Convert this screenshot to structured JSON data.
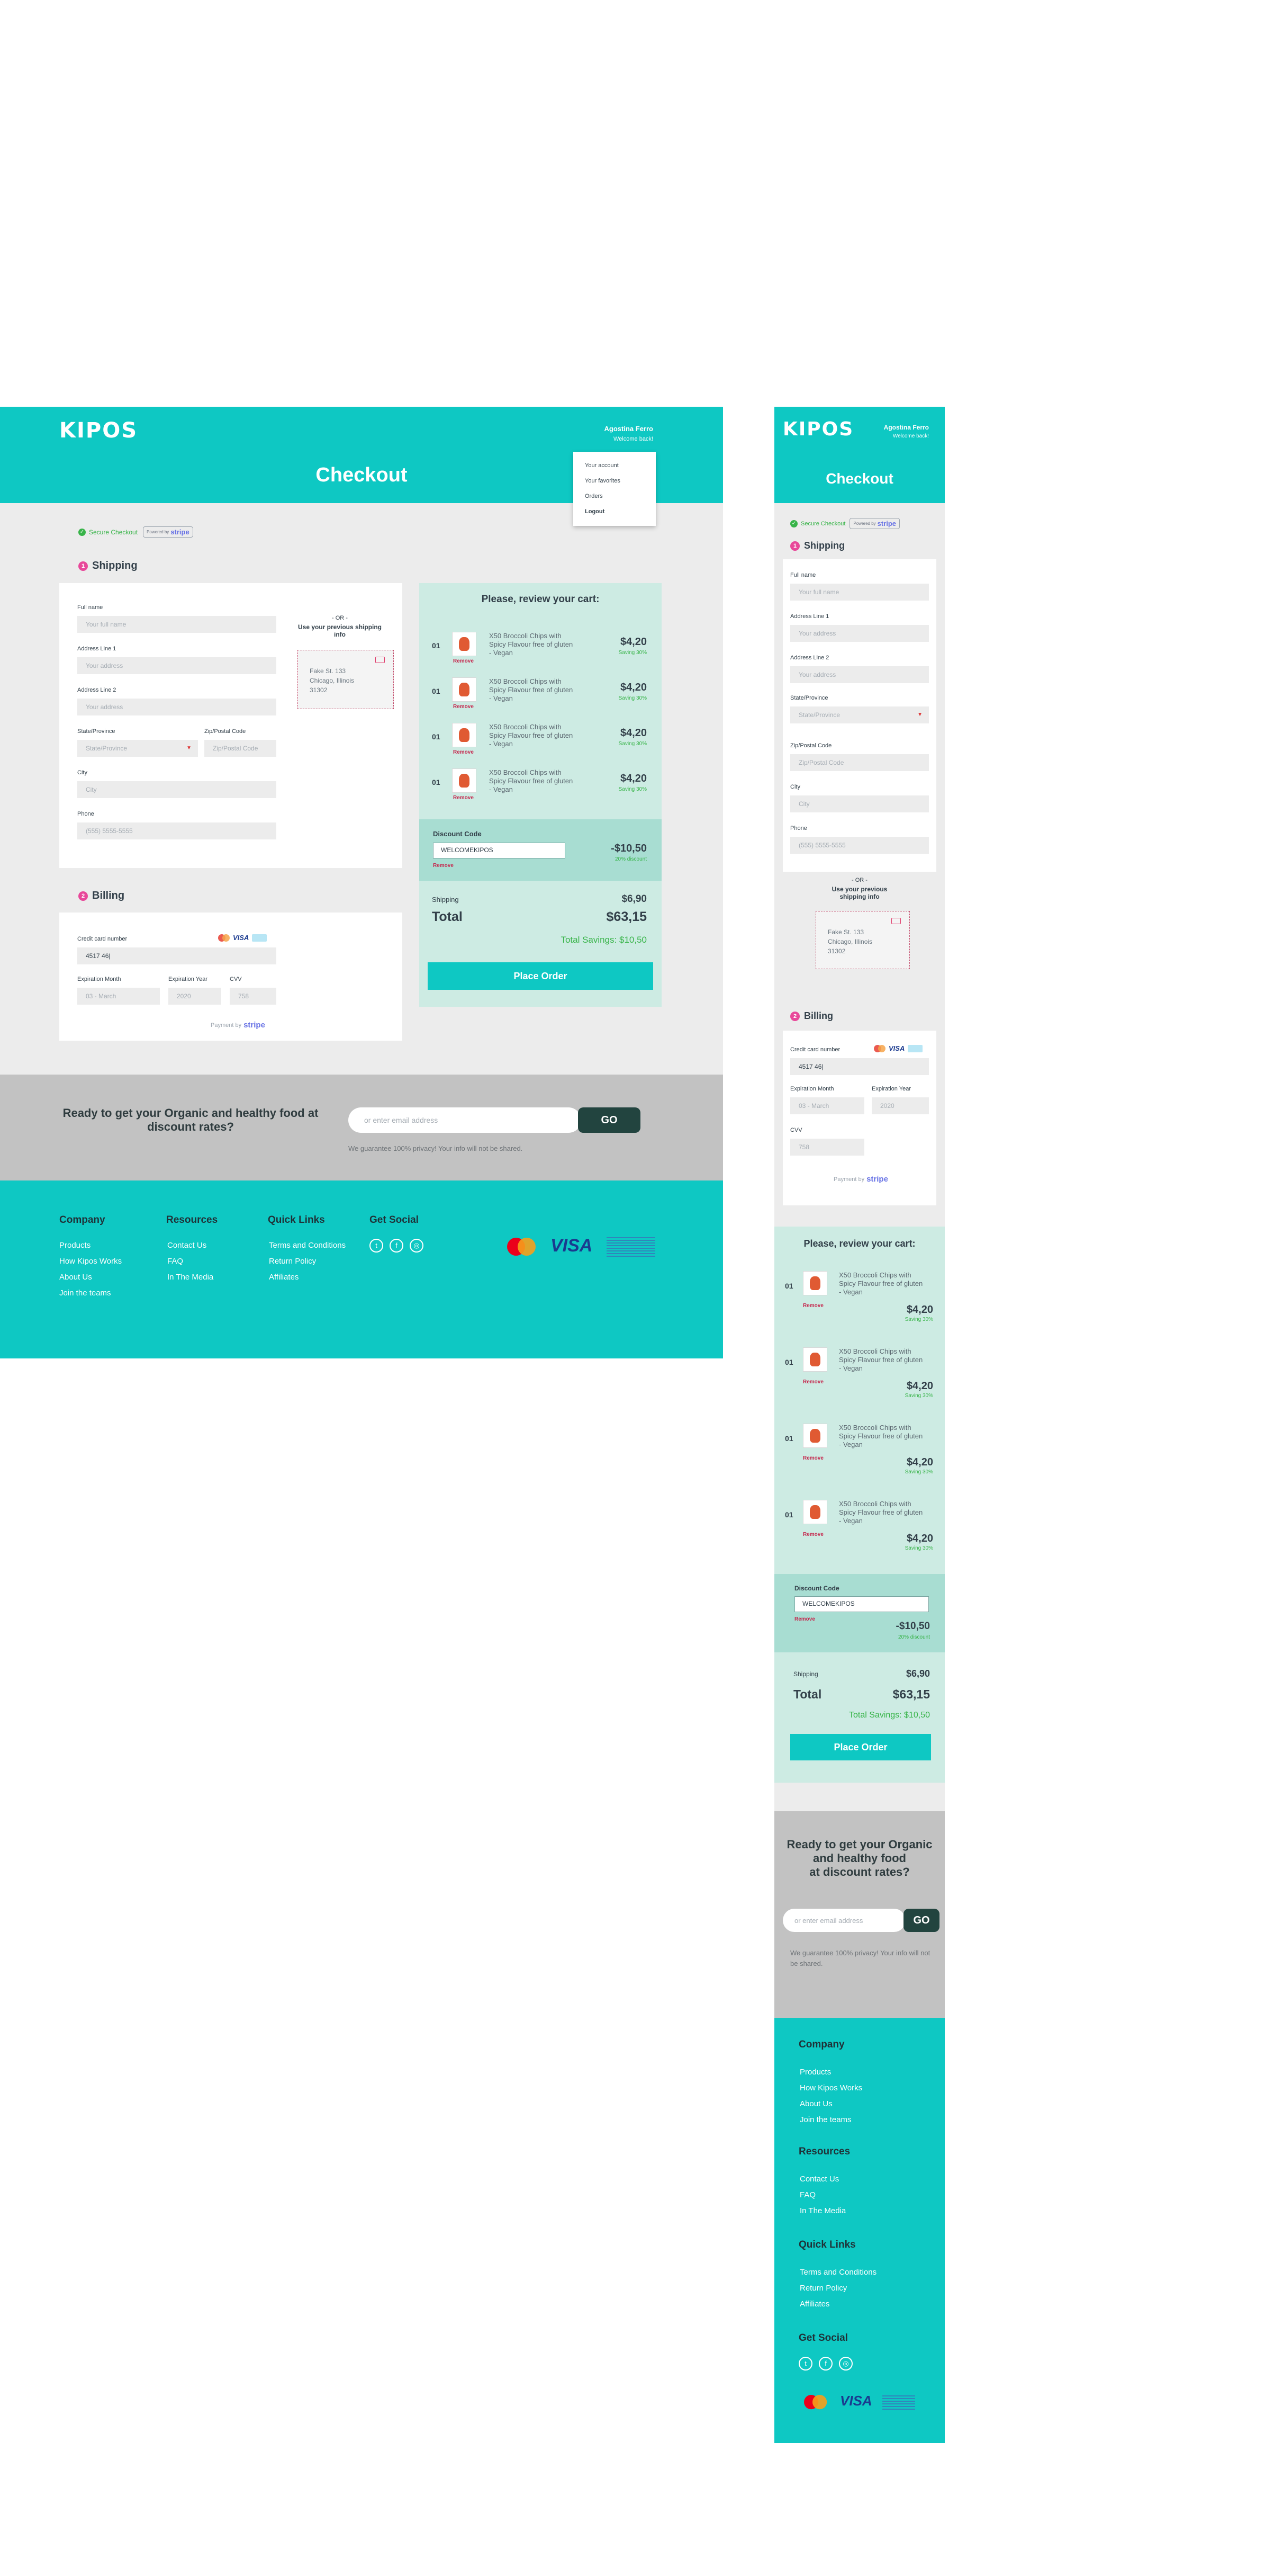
{
  "brand": {
    "logo": "KIPOS"
  },
  "user": {
    "name": "Agostina Ferro",
    "greeting": "Welcome back!"
  },
  "menu": {
    "items": [
      "Your account",
      "Your favorites",
      "Orders",
      "Logout"
    ]
  },
  "page": {
    "title": "Checkout"
  },
  "secure": {
    "label": "Secure Checkout",
    "powered": "Powered by",
    "stripe": "stripe"
  },
  "shipping": {
    "title": "Shipping",
    "step": "1",
    "full_name_label": "Full name",
    "full_name_ph": "Your full name",
    "addr1_label": "Address Line 1",
    "addr1_ph": "Your address",
    "addr2_label": "Address Line 2",
    "addr2_ph": "Your address",
    "state_label": "State/Province",
    "state_ph": "State/Province",
    "zip_label": "Zip/Postal Code",
    "zip_ph": "Zip/Postal Code",
    "city_label": "City",
    "city_ph": "City",
    "phone_label": "Phone",
    "phone_ph": "(555) 5555-5555",
    "or": "- OR -",
    "prev_title": "Use your previous shipping info",
    "prev_l1": "Fake St. 133",
    "prev_l2": "Chicago, Illinois",
    "prev_l3": "31302"
  },
  "billing": {
    "title": "Billing",
    "step": "2",
    "cc_label": "Credit card number",
    "cc_value": "4517 46|",
    "month_label": "Expiration Month",
    "month_ph": "03 - March",
    "year_label": "Expiration Year",
    "year_ph": "2020",
    "cvv_label": "CVV",
    "cvv_ph": "758",
    "payment_by": "Payment by",
    "stripe": "stripe"
  },
  "cart": {
    "title": "Please, review your cart:",
    "items": [
      {
        "qty": "01",
        "name": "X50 Broccoli Chips with Spicy Flavour free of gluten - Vegan",
        "price": "$4,20",
        "saving": "Saving 30%",
        "remove": "Remove"
      },
      {
        "qty": "01",
        "name": "X50 Broccoli Chips with Spicy Flavour free of gluten - Vegan",
        "price": "$4,20",
        "saving": "Saving 30%",
        "remove": "Remove"
      },
      {
        "qty": "01",
        "name": "X50 Broccoli Chips with Spicy Flavour free of gluten - Vegan",
        "price": "$4,20",
        "saving": "Saving 30%",
        "remove": "Remove"
      },
      {
        "qty": "01",
        "name": "X50 Broccoli Chips with Spicy Flavour free of gluten - Vegan",
        "price": "$4,20",
        "saving": "Saving 30%",
        "remove": "Remove"
      }
    ],
    "discount_label": "Discount Code",
    "discount_value": "WELCOMEKIPOS",
    "discount_remove": "Remove",
    "discount_amount": "-$10,50",
    "discount_pct": "20% discount",
    "shipping_label": "Shipping",
    "shipping_value": "$6,90",
    "total_label": "Total",
    "total_value": "$63,15",
    "savings": "Total Savings: $10,50",
    "place_order": "Place Order"
  },
  "newsletter": {
    "title_d": "Ready to get your Organic and healthy food at discount rates?",
    "title_m1": "Ready to get your Organic",
    "title_m2": "and healthy food",
    "title_m3": "at discount rates?",
    "placeholder": "or enter email address",
    "go": "GO",
    "note": "We guarantee 100% privacy! Your info will not be shared."
  },
  "footer": {
    "company": {
      "title": "Company",
      "links": [
        "Products",
        "How Kipos Works",
        "About Us",
        "Join the teams"
      ]
    },
    "resources": {
      "title": "Resources",
      "links": [
        "Contact Us",
        "FAQ",
        "In The Media"
      ]
    },
    "quick": {
      "title": "Quick Links",
      "links": [
        "Terms and Conditions",
        "Return Policy",
        "Affiliates"
      ]
    },
    "social": {
      "title": "Get Social",
      "icons": [
        "twitter-icon",
        "facebook-icon",
        "instagram-icon"
      ]
    },
    "payments": {
      "visa": "VISA"
    }
  },
  "colors": {
    "teal": "#0ec8c3",
    "pink": "#e8489a",
    "green": "#38b449",
    "dark": "#22443f",
    "review_bg": "#cdebe3",
    "remove_red": "#c5284e"
  }
}
